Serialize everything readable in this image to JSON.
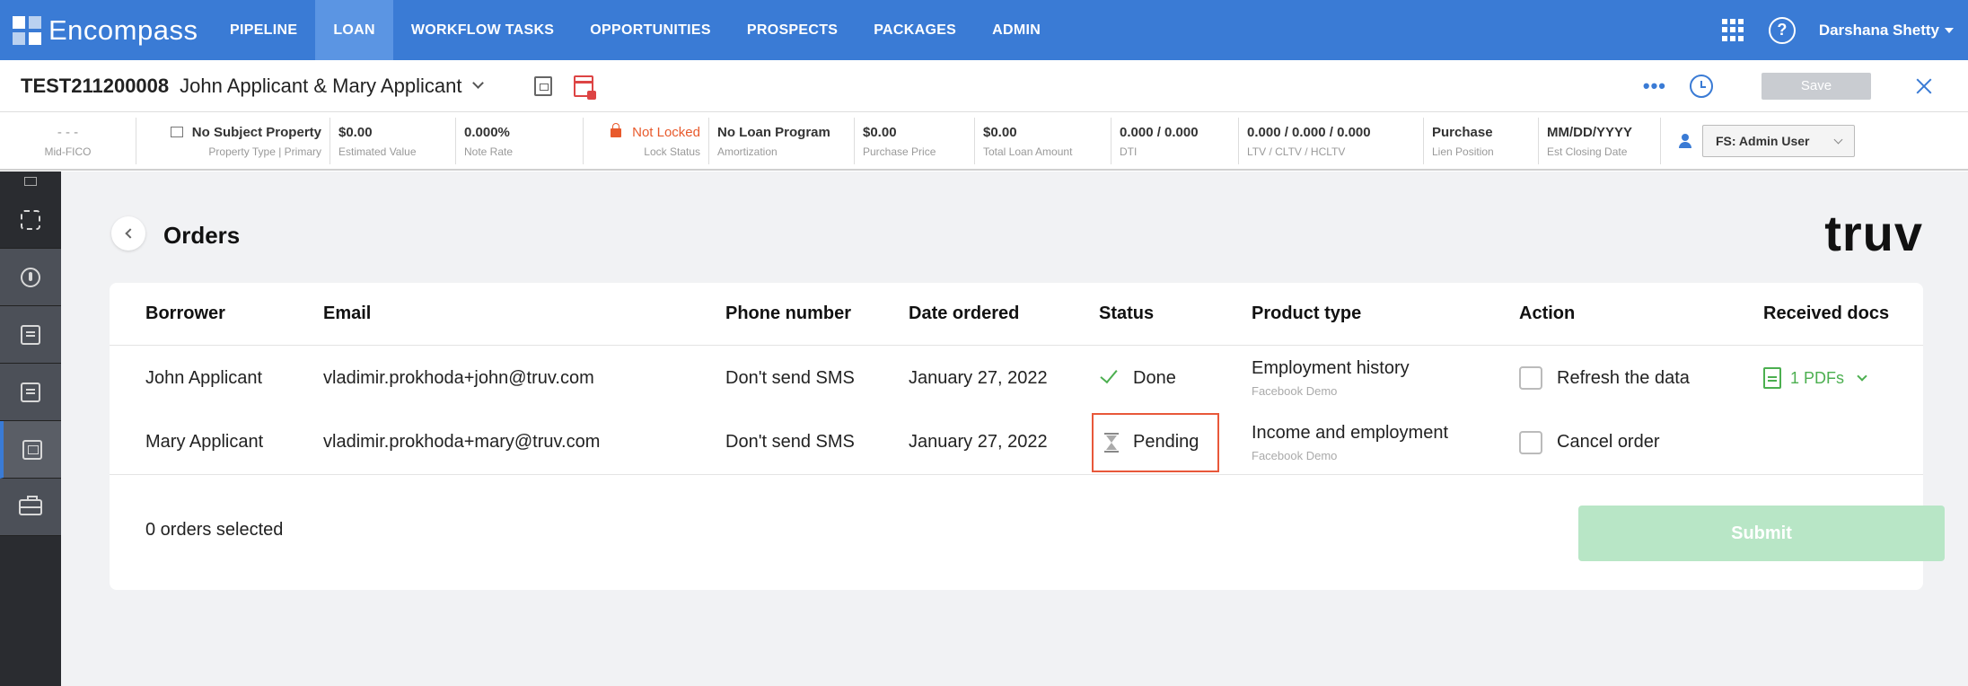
{
  "app": {
    "brand": "Encompass"
  },
  "nav": {
    "items": [
      {
        "label": "PIPELINE",
        "active": false
      },
      {
        "label": "LOAN",
        "active": true
      },
      {
        "label": "WORKFLOW TASKS",
        "active": false
      },
      {
        "label": "OPPORTUNITIES",
        "active": false
      },
      {
        "label": "PROSPECTS",
        "active": false
      },
      {
        "label": "PACKAGES",
        "active": false
      },
      {
        "label": "ADMIN",
        "active": false
      }
    ],
    "user": "Darshana Shetty"
  },
  "loan": {
    "id": "TEST211200008",
    "borrowers": "John Applicant & Mary Applicant",
    "more": "•••",
    "save_label": "Save"
  },
  "info": {
    "mid_fico": {
      "value": "- - -",
      "label": "Mid-FICO"
    },
    "property": {
      "value": "No Subject Property",
      "label": "Property Type | Primary"
    },
    "estimated_value": {
      "value": "$0.00",
      "label": "Estimated Value"
    },
    "note_rate": {
      "value": "0.000%",
      "label": "Note Rate"
    },
    "lock_status": {
      "value": "Not Locked",
      "label": "Lock Status"
    },
    "amortization": {
      "value": "No Loan Program",
      "label": "Amortization"
    },
    "purchase_price": {
      "value": "$0.00",
      "label": "Purchase Price"
    },
    "total_loan_amount": {
      "value": "$0.00",
      "label": "Total Loan Amount"
    },
    "dti": {
      "value": "0.000 / 0.000",
      "label": "DTI"
    },
    "ltv": {
      "value": "0.000 / 0.000 / 0.000",
      "label": "LTV / CLTV / HCLTV"
    },
    "lien": {
      "value": "Purchase",
      "label": "Lien Position"
    },
    "closing": {
      "value": "MM/DD/YYYY",
      "label": "Est Closing Date"
    },
    "persona": "FS: Admin User"
  },
  "orders": {
    "title": "Orders",
    "logo": "truv",
    "columns": {
      "borrower": "Borrower",
      "email": "Email",
      "phone": "Phone number",
      "date": "Date ordered",
      "status": "Status",
      "product": "Product type",
      "action": "Action",
      "docs": "Received docs"
    },
    "rows": [
      {
        "borrower": "John Applicant",
        "email": "vladimir.prokhoda+john@truv.com",
        "phone": "Don't send SMS",
        "date": "January 27, 2022",
        "status": "Done",
        "product": "Employment history",
        "product_sub": "Facebook Demo",
        "action": "Refresh the data",
        "docs": "1 PDFs"
      },
      {
        "borrower": "Mary Applicant",
        "email": "vladimir.prokhoda+mary@truv.com",
        "phone": "Don't send SMS",
        "date": "January 27, 2022",
        "status": "Pending",
        "product": "Income and employment",
        "product_sub": "Facebook Demo",
        "action": "Cancel order",
        "docs": ""
      }
    ],
    "selected_count": "0 orders selected",
    "submit_label": "Submit"
  },
  "colors": {
    "brand_blue": "#3a7bd5",
    "done_green": "#4caf50",
    "pending_outline": "#e8583a",
    "submit_disabled": "#b8e6c6"
  }
}
